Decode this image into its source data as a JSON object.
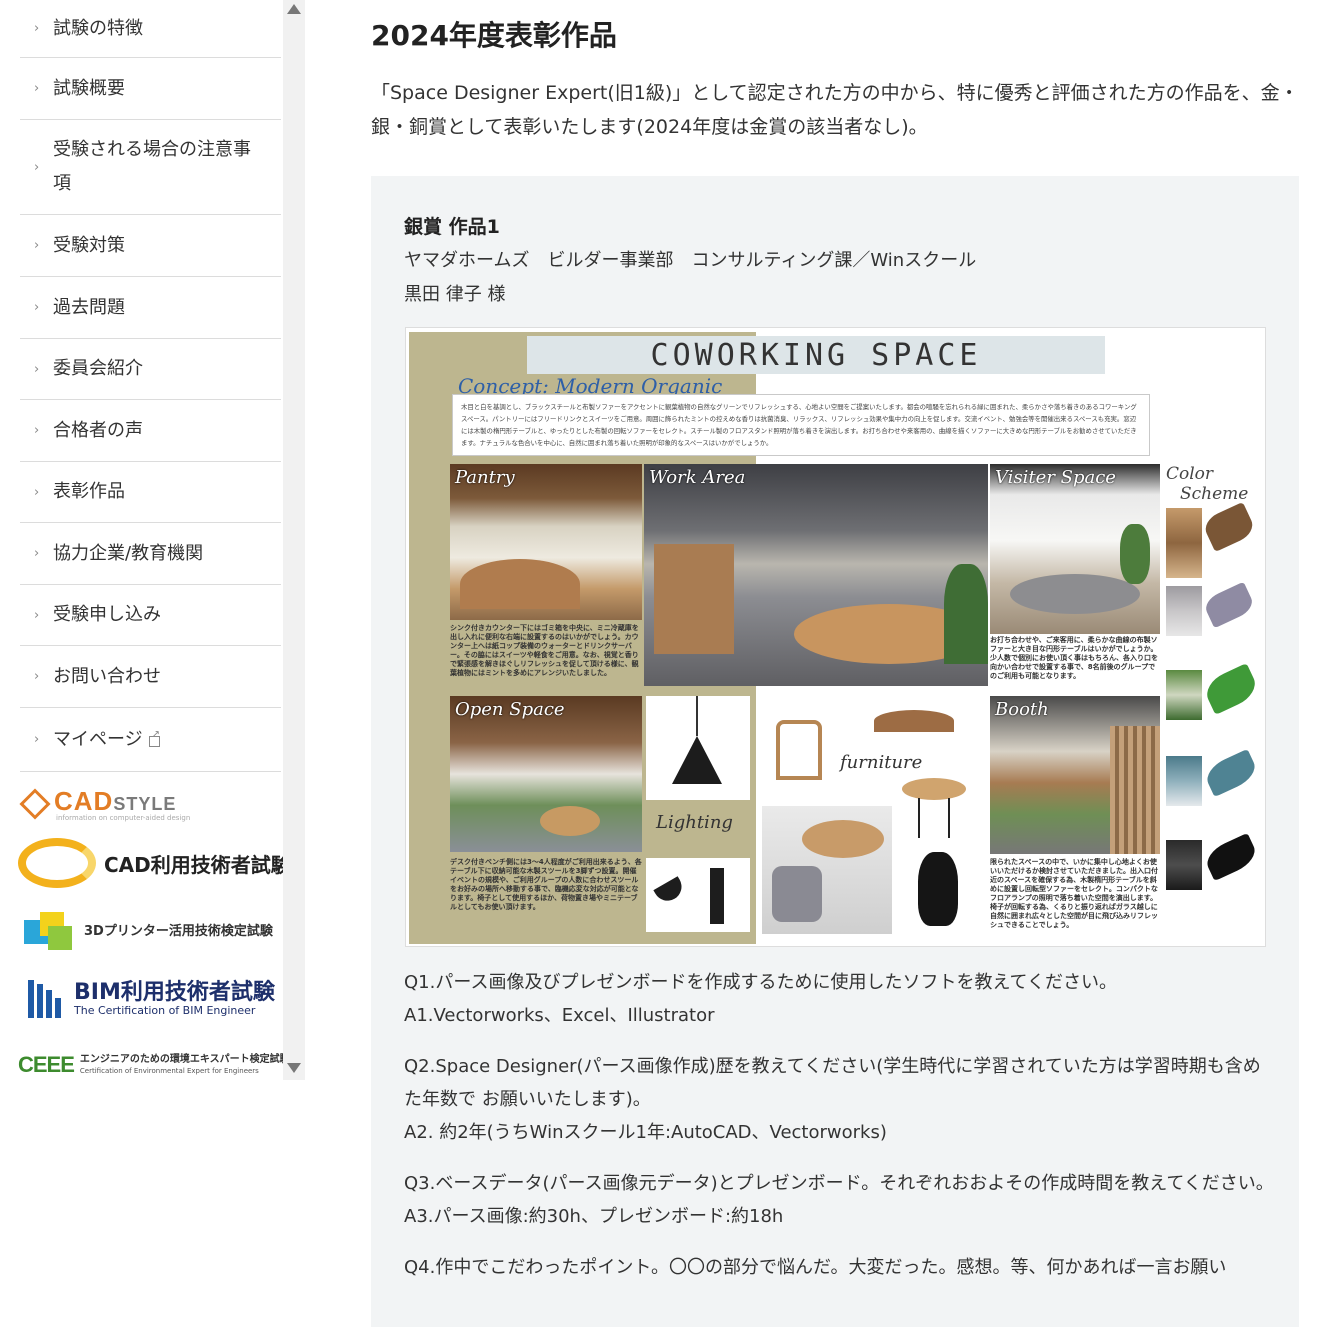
{
  "sidebar": {
    "items": [
      {
        "label": "試験の特徴"
      },
      {
        "label": "試験概要"
      },
      {
        "label": "受験される場合の注意事項"
      },
      {
        "label": "受験対策"
      },
      {
        "label": "過去問題"
      },
      {
        "label": "委員会紹介"
      },
      {
        "label": "合格者の声"
      },
      {
        "label": "表彰作品"
      },
      {
        "label": "協力企業/教育機関"
      },
      {
        "label": "受験申し込み"
      },
      {
        "label": "お問い合わせ"
      },
      {
        "label": "マイページ",
        "external": true
      }
    ],
    "logos": {
      "cadstyle": {
        "main": "CAD",
        "suffix": "STYLE",
        "sub": "information on computer-aided design"
      },
      "cadexam": {
        "text": "CAD利用技術者試験"
      },
      "printer3d": {
        "text": "3Dプリンター活用技術検定試験"
      },
      "bim": {
        "line1": "BIM利用技術者試験",
        "line2": "The Certification of BIM Engineer"
      },
      "ceee": {
        "mark": "CEEE",
        "line1": "エンジニアのための環境エキスパート検定試験",
        "line2": "Certification of Environmental Expert for Engineers"
      }
    }
  },
  "main": {
    "title": "2024年度表彰作品",
    "intro": "「Space Designer Expert(旧1級)」として認定された方の中から、特に優秀と評価された方の作品を、金・銀・銅賞として表彰いたします(2024年度は金賞の該当者なし)。",
    "award": {
      "heading": "銀賞 作品1",
      "company": "ヤマダホームズ　ビルダー事業部　コンサルティング課／Winスクール",
      "winner": "黒田 律子 様",
      "board": {
        "title": "COWORKING SPACE",
        "concept": "Concept: Modern Organic",
        "description": "木目と白を基調とし、ブラックスチールと布製ソファーをアクセントに観葉植物の自然なグリーンでリフレッシュする、心地よい空間をご提案いたします。都会の喧騒を忘れられる緑に囲まれた、柔らかさや落ち着きのあるコワーキングスペース。パントリーにはフリードリンクとスイーツをご用意。周囲に飾られたミントの控えめな香りは抗菌消臭、リラックス、リフレッシュ効果や集中力の向上を促します。交流イベント、勉強会等を開催出来るスペースも充実。窓辺には木製の楕円形テーブルと、ゆったりとした布製の回転ソファーをセレクト。スチール製のフロアスタンド照明が落ち着きを演出します。お打ち合わせや来客用の、曲線を描くソファーに大きめな円形テーブルをお勧めさせていただきます。ナチュラルな色合いを中心に、自然に囲まれ落ち着いた照明が印象的なスペースはいかがでしょうか。",
        "labels": {
          "pantry": "Pantry",
          "work_area": "Work Area",
          "visitor_space": "Visiter Space",
          "color_scheme_1": "Color",
          "color_scheme_2": "Scheme",
          "open_space": "Open Space",
          "lighting": "Lighting",
          "furniture": "furniture",
          "booth": "Booth"
        },
        "captions": {
          "pantry": "シンク付きカウンター下にはゴミ箱を中央に、ミニ冷蔵庫を出し入れに便利な右端に設置するのはいかがでしょう。カウンター上へは紙コップ装備のウォーターとドリンクサーバー。その脇にはスイーツや軽食をご用意。なお、視覚と香りで緊張感を解きほぐしリフレッシュを促して頂ける様に、観葉植物にはミントを多めにアレンジいたしました。",
          "visitor": "お打ち合わせや、ご来客用に、柔らかな曲線の布製ソファーと大き目な円形テーブルはいかがでしょうか。少人数で個別にお使い頂く事はもちろん、各入り口を向かい合わせで設置する事で、8名前後のグループでのご利用も可能となります。",
          "open": "デスク付きベンチ側には3〜4人程度がご利用出来るよう、各テーブル下に収納可能な木製スツールを3脚ずつ設置。開催イベントの規模や、ご利用グループの人数に合わせスツールをお好みの場所へ移動する事で、臨機応変な対応が可能となります。椅子として使用するほか、荷物置き場やミニテーブルとしてもお使い頂けます。",
          "booth": "限られたスペースの中で、いかに集中し心地よくお使いいただけるか検討させていただきました。出入口付近のスペースを確保する為、木製楕円形テーブルを斜めに設置し回転型ソファーをセレクト。コンパクトなフロアランプの照明で落ち着いた空間を演出します。椅子が回転する為、くるりと振り返ればガラス越しに自然に囲まれ広々とした空間が目に飛び込みリフレッシュできることでしょう。"
        }
      },
      "qa": [
        {
          "q": "Q1.パース画像及びプレゼンボードを作成するために使用したソフトを教えてください。",
          "a": "A1.Vectorworks、Excel、Illustrator"
        },
        {
          "q": "Q2.Space Designer(パース画像作成)歴を教えてください(学生時代に学習されていた方は学習時期も含めた年数で お願いいたします)。",
          "a": "A2. 約2年(うちWinスクール1年:AutoCAD、Vectorworks)"
        },
        {
          "q": "Q3.ベースデータ(パース画像元データ)とプレゼンボード。それぞれおおよその作成時間を教えてください。",
          "a": "A3.パース画像:約30h、プレゼンボード:約18h"
        },
        {
          "q": "Q4.作中でこだわったポイント。〇〇の部分で悩んだ。大変だった。感想。等、何かあれば一言お願い",
          "a": ""
        }
      ]
    }
  },
  "colors": {
    "olive": "#bdb68f",
    "panel_bg": "#f2f4f5",
    "accent_orange": "#e37d25",
    "bim_blue": "#1d2f6b"
  }
}
